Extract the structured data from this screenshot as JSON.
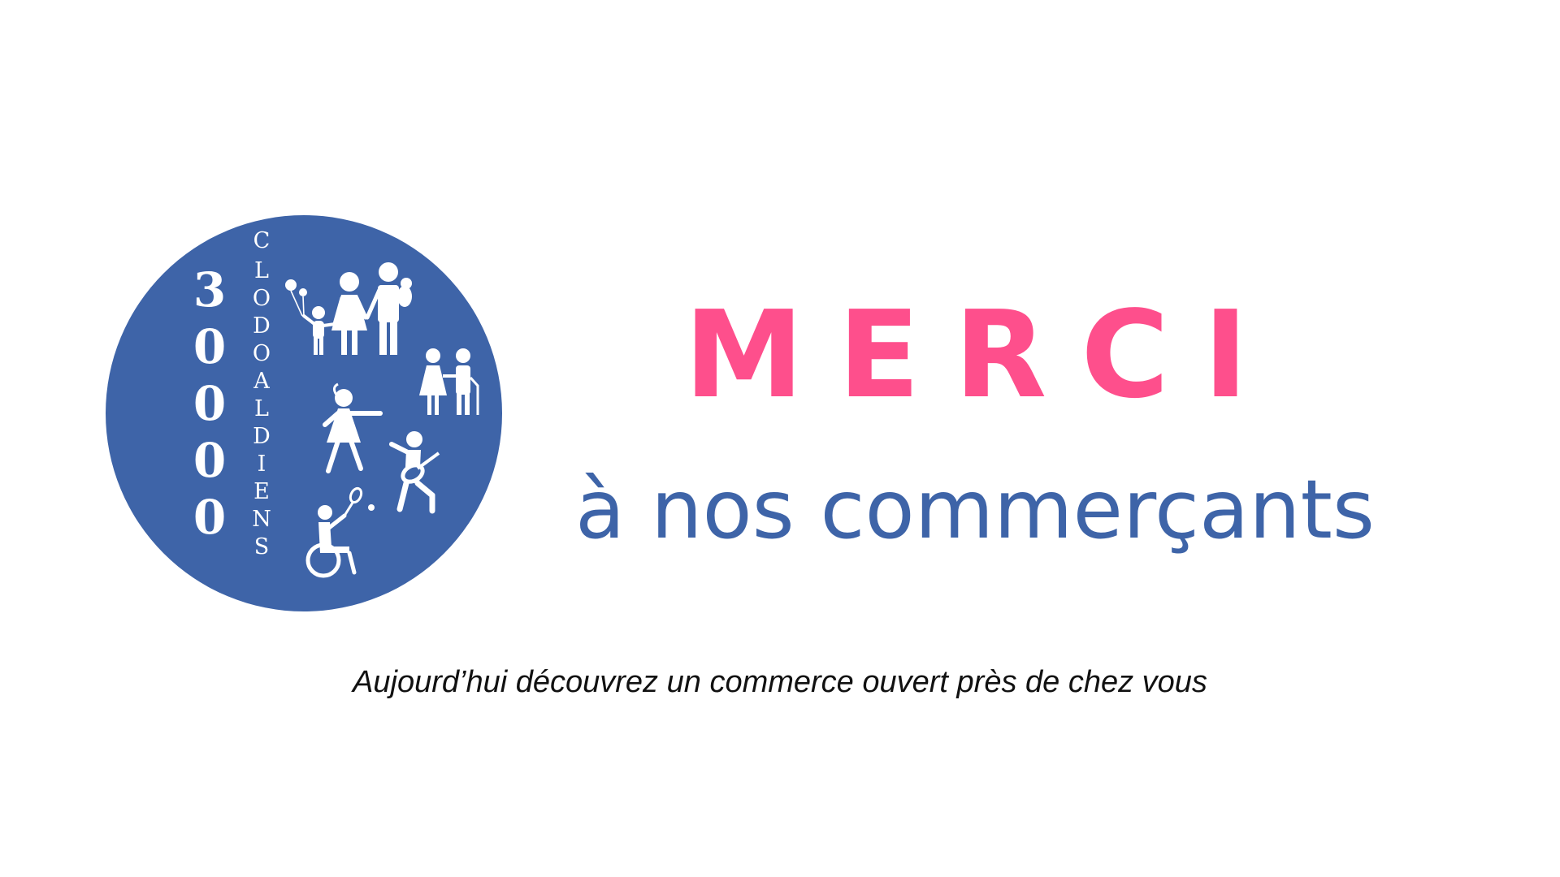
{
  "logo": {
    "number_digits": [
      "3",
      "0",
      "0",
      "0",
      "0"
    ],
    "word_letters": [
      "C",
      "L",
      "O",
      "D",
      "O",
      "A",
      "L",
      "D",
      "I",
      "E",
      "N",
      "S"
    ],
    "circle_color": "#3e64a8",
    "icons": [
      "family-icon",
      "elderly-couple-icon",
      "dancer-icon",
      "guitarist-icon",
      "wheelchair-tennis-icon"
    ]
  },
  "headline": {
    "text": "MERCI",
    "color": "#fe4f8c"
  },
  "subheadline": {
    "text": "à nos commerçants",
    "color": "#3e64a8"
  },
  "tagline": {
    "text": "Aujourd’hui découvrez un commerce ouvert près de chez vous"
  }
}
